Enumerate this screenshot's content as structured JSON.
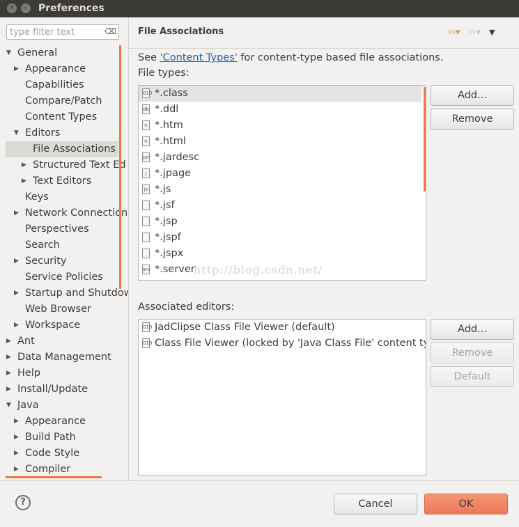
{
  "window": {
    "title": "Preferences",
    "close_glyph": "✕",
    "minimize_glyph": "–"
  },
  "filter": {
    "placeholder": "type filter text",
    "clear_glyph": "⌫"
  },
  "tree": [
    {
      "label": "General",
      "arrow": "▼"
    },
    {
      "label": "Appearance",
      "arrow": "▶"
    },
    {
      "label": "Capabilities",
      "arrow": ""
    },
    {
      "label": "Compare/Patch",
      "arrow": ""
    },
    {
      "label": "Content Types",
      "arrow": ""
    },
    {
      "label": "Editors",
      "arrow": "▼"
    },
    {
      "label": "File Associations",
      "arrow": ""
    },
    {
      "label": "Structured Text Ed",
      "arrow": "▶"
    },
    {
      "label": "Text Editors",
      "arrow": "▶"
    },
    {
      "label": "Keys",
      "arrow": ""
    },
    {
      "label": "Network Connection",
      "arrow": "▶"
    },
    {
      "label": "Perspectives",
      "arrow": ""
    },
    {
      "label": "Search",
      "arrow": ""
    },
    {
      "label": "Security",
      "arrow": "▶"
    },
    {
      "label": "Service Policies",
      "arrow": ""
    },
    {
      "label": "Startup and Shutdow",
      "arrow": "▶"
    },
    {
      "label": "Web Browser",
      "arrow": ""
    },
    {
      "label": "Workspace",
      "arrow": "▶"
    },
    {
      "label": "Ant",
      "arrow": "▶"
    },
    {
      "label": "Data Management",
      "arrow": "▶"
    },
    {
      "label": "Help",
      "arrow": "▶"
    },
    {
      "label": "Install/Update",
      "arrow": "▶"
    },
    {
      "label": "Java",
      "arrow": "▼"
    },
    {
      "label": "Appearance",
      "arrow": "▶"
    },
    {
      "label": "Build Path",
      "arrow": "▶"
    },
    {
      "label": "Code Style",
      "arrow": "▶"
    },
    {
      "label": "Compiler",
      "arrow": "▶"
    }
  ],
  "page": {
    "heading": "File Associations",
    "back_glyph": "⇦▾",
    "forward_glyph": "⇨▾",
    "menu_glyph": "▼",
    "see_prefix": "See ",
    "see_link": "'Content Types'",
    "see_suffix": " for content-type based file associations.",
    "file_types_label": "File types:",
    "file_types": [
      "*.class",
      "*.ddl",
      "*.htm",
      "*.html",
      "*.jardesc",
      "*.jpage",
      "*.js",
      "*.jsf",
      "*.jsp",
      "*.jspf",
      "*.jspx",
      "*.server"
    ],
    "file_type_icons": [
      "010",
      "db",
      "e",
      "e",
      "jar",
      "J",
      "js",
      "",
      "",
      "",
      "",
      "srv"
    ],
    "watermark": "http://blog.csdn.net/",
    "assoc_label": "Associated editors:",
    "editors": [
      "JadClipse Class File Viewer (default)",
      "Class File Viewer (locked by 'Java Class File' content type)"
    ],
    "editor_icons": [
      "010",
      "010"
    ],
    "buttons": {
      "add_types": "Add...",
      "remove_types": "Remove",
      "add_editor": "Add...",
      "remove_editor": "Remove",
      "default_editor": "Default"
    }
  },
  "dialog": {
    "help": "?",
    "cancel": "Cancel",
    "ok": "OK"
  },
  "colors": {
    "accent": "#f07746",
    "titlebar": "#3c3b37",
    "link": "#2563a6"
  }
}
